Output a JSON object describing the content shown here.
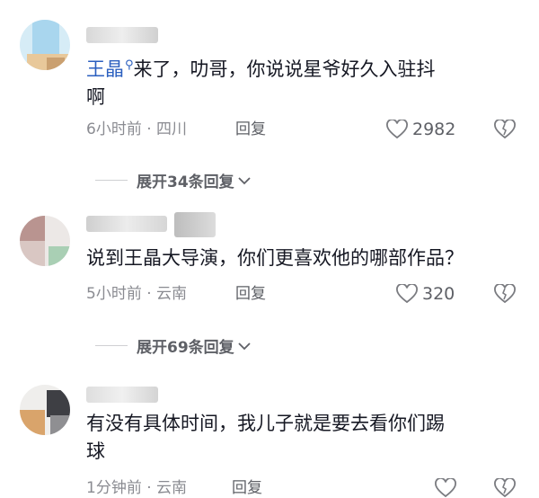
{
  "comments": [
    {
      "mention": "王晶",
      "text": "来了，叻哥，你说说星爷好久入驻抖",
      "text_line2": "啊",
      "time": "6小时前",
      "location": "四川",
      "reply_label": "回复",
      "likes": "2982"
    },
    {
      "text": "说到王晶大导演，你们更喜欢他的哪部作品？",
      "time": "5小时前",
      "location": "云南",
      "reply_label": "回复",
      "likes": "320"
    },
    {
      "text": "有没有具体时间，我儿子就是要去看你们踢",
      "text_line2": "球",
      "time": "1分钟前",
      "location": "云南",
      "reply_label": "回复"
    }
  ],
  "expand": [
    {
      "label": "展开34条回复"
    },
    {
      "label": "展开69条回复"
    }
  ],
  "meta_separator": " · ",
  "colors": {
    "mention": "#2b5fbf",
    "meta": "#8a8b91",
    "text": "#161823"
  },
  "icons": [
    "heart-outline-icon",
    "broken-heart-icon",
    "chevron-down-icon",
    "search-icon"
  ]
}
